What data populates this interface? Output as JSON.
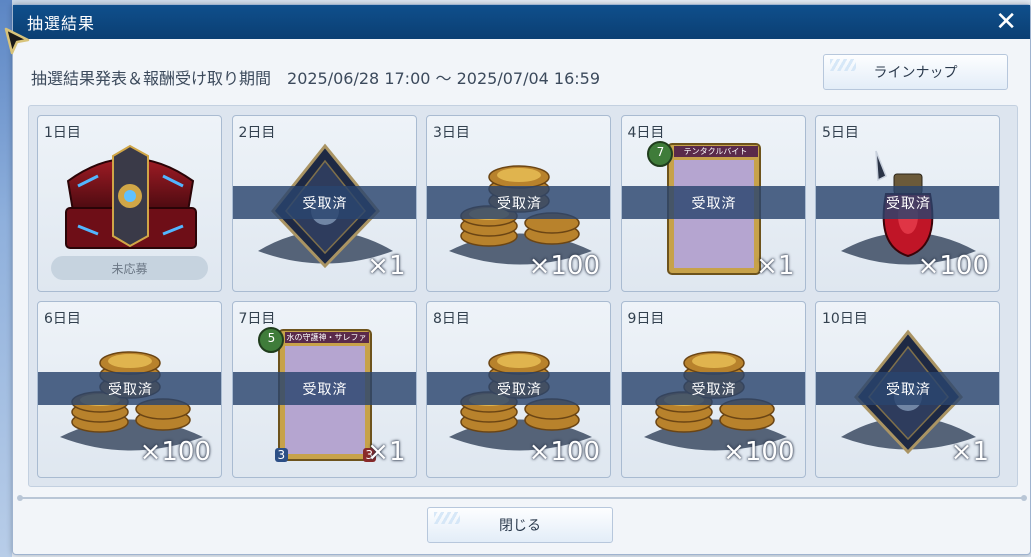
{
  "dialog": {
    "title": "抽選結果",
    "close_glyph": "✕",
    "period_label": "抽選結果発表＆報酬受け取り期間",
    "period_value": "2025/06/28 17:00 ～ 2025/07/04 16:59",
    "lineup_button": "ラインナップ",
    "close_button": "閉じる"
  },
  "days": [
    {
      "label": "1日目",
      "item": "treasure-chest",
      "quantity": "",
      "status": "未応募",
      "claimed": false
    },
    {
      "label": "2日目",
      "item": "crystal-plate",
      "quantity": "×1",
      "status": "受取済",
      "claimed": true
    },
    {
      "label": "3日目",
      "item": "coin-stack",
      "quantity": "×100",
      "status": "受取済",
      "claimed": true
    },
    {
      "label": "4日目",
      "item": "card",
      "quantity": "×1",
      "status": "受取済",
      "claimed": true,
      "card_cost": "7",
      "card_title": "テンタクルバイト"
    },
    {
      "label": "5日目",
      "item": "potion",
      "quantity": "×100",
      "status": "受取済",
      "claimed": true
    },
    {
      "label": "6日目",
      "item": "coin-stack",
      "quantity": "×100",
      "status": "受取済",
      "claimed": true
    },
    {
      "label": "7日目",
      "item": "card",
      "quantity": "×1",
      "status": "受取済",
      "claimed": true,
      "card_cost": "5",
      "card_title": "水の守護神・サレファ",
      "card_atk": "3",
      "card_def": "3"
    },
    {
      "label": "8日目",
      "item": "coin-stack",
      "quantity": "×100",
      "status": "受取済",
      "claimed": true
    },
    {
      "label": "9日目",
      "item": "coin-stack",
      "quantity": "×100",
      "status": "受取済",
      "claimed": true
    },
    {
      "label": "10日目",
      "item": "crystal-plate",
      "quantity": "×1",
      "status": "受取済",
      "claimed": true
    }
  ],
  "colors": {
    "titlebar": "#0b3f73",
    "claimed_banner": "#2a446e",
    "panel": "#dde5ef"
  }
}
